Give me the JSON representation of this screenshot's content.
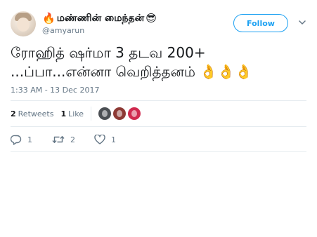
{
  "user": {
    "fire_emoji": "🔥",
    "display_name": "மண்ணின் மைந்தன்",
    "cool_emoji": "😎",
    "handle": "@amyarun"
  },
  "follow_label": "Follow",
  "tweet": {
    "line1": "ரோஹித் ஷர்மா 3 தடவ 200+",
    "line2": "...ப்பா...என்னா வெறித்தனம் 👌👌👌"
  },
  "timestamp": "1:33 AM - 13 Dec 2017",
  "stats": {
    "retweets_count": "2",
    "retweets_label": "Retweets",
    "likes_count": "1",
    "likes_label": "Like"
  },
  "actions": {
    "reply_count": "1",
    "retweet_count": "2",
    "like_count": "1"
  },
  "icons": {
    "reply": "reply-icon",
    "retweet": "retweet-icon",
    "like": "heart-icon",
    "more": "chevron-down-icon"
  },
  "colors": {
    "accent": "#1da1f2",
    "muted": "#657786",
    "text": "#14171a",
    "divider": "#e6ecf0"
  }
}
